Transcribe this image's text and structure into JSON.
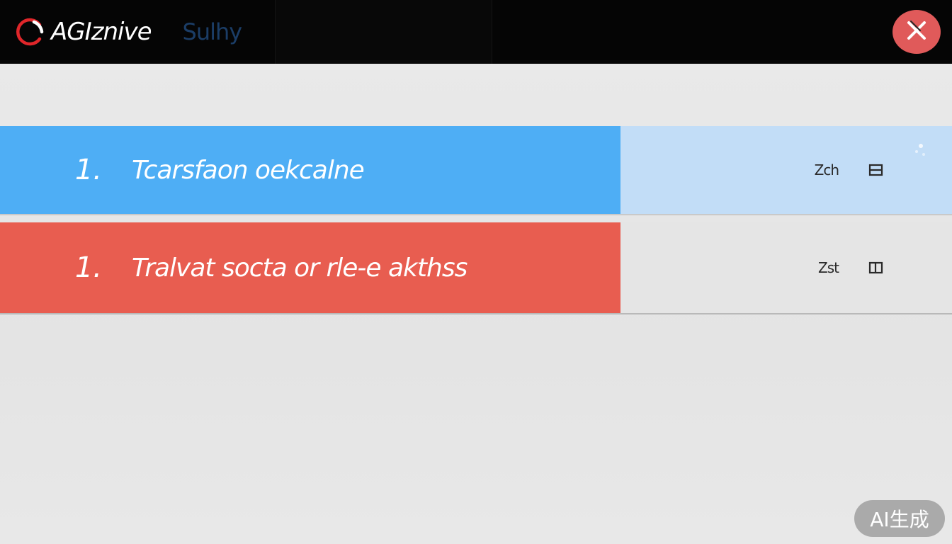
{
  "header": {
    "app_name": "AGIznive",
    "tab_label": "Sulhy",
    "close_icon": "close-icon",
    "colors": {
      "bar": "#060606",
      "close_button": "#e05a5a",
      "logo_accent": "#e0262a",
      "tab_text": "#1b3d66"
    }
  },
  "list": {
    "items": [
      {
        "number": "1.",
        "title": "Tcarsfaon oekcalne",
        "meta_value": "Zch",
        "meta_icon": "list-icon",
        "color": "#4eaef5",
        "selected": true
      },
      {
        "number": "1.",
        "title": "Tralvat socta or rle-e akthss",
        "meta_value": "Zst",
        "meta_icon": "list-icon",
        "color": "#e85d50",
        "selected": false
      }
    ]
  },
  "watermark": {
    "text": "AI生成"
  }
}
